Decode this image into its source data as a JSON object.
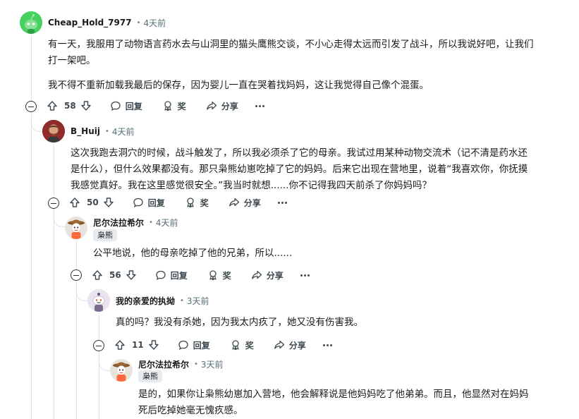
{
  "colors": {
    "text": "#1a1a1b",
    "meta": "#576f76",
    "rail": "#e0e2e5",
    "flair_bg": "#e5ebee",
    "avatar_green": "#46d160"
  },
  "icons": [
    "upvote-icon",
    "downvote-icon",
    "reply-icon",
    "award-icon",
    "share-icon",
    "more-icon",
    "collapse-icon"
  ],
  "comments": [
    {
      "author": "Cheap_Hold_7977",
      "time": "4天前",
      "body": [
        "有一天，我服用了动物语言药水去与山洞里的猫头鹰熊交谈，不小心走得太远而引发了战斗，所以我说好吧，让我们打一架吧。",
        "我不得不重新加载我最后的保存，因为婴儿一直在哭着找妈妈，这让我觉得自己像个混蛋。"
      ],
      "votes": "58",
      "reply": "回复",
      "award": "奖",
      "share": "分享"
    },
    {
      "author": "B_Huij",
      "time": "4天前",
      "body": [
        "这次我跑去洞穴的时候，战斗触发了，所以我必须杀了它的母亲。我试过用某种动物交流术（记不清是药水还是什么），但什么效果都没有。那只枭熊幼崽吃掉了它的妈妈。后来它出现在营地里，说着“我喜欢你，你抚摸我感觉真好。我在这里感觉很安全。”我当时就想......你不记得我四天前杀了你妈妈吗？"
      ],
      "votes": "50",
      "reply": "回复",
      "award": "奖",
      "share": "分享"
    },
    {
      "author": "尼尔法拉希尔",
      "time": "4天前",
      "flair": "枭熊",
      "body": [
        "公平地说，他的母亲吃掉了他的兄弟，所以......"
      ],
      "votes": "56",
      "reply": "回复",
      "award": "奖",
      "share": "分享"
    },
    {
      "author": "我的亲爱的执拗",
      "time": "3天前",
      "body": [
        "真的吗？我没有杀她，因为我太内疚了，她又没有伤害我。"
      ],
      "votes": "11",
      "reply": "回复",
      "award": "奖",
      "share": "分享"
    },
    {
      "author": "尼尔法拉希尔",
      "time": "3天前",
      "flair": "枭熊",
      "body": [
        "是的，如果你让枭熊幼崽加入营地，他会解释说是他妈妈吃了他弟弟。而且，他显然对在妈妈死后吃掉她毫无愧疚感。"
      ]
    }
  ]
}
